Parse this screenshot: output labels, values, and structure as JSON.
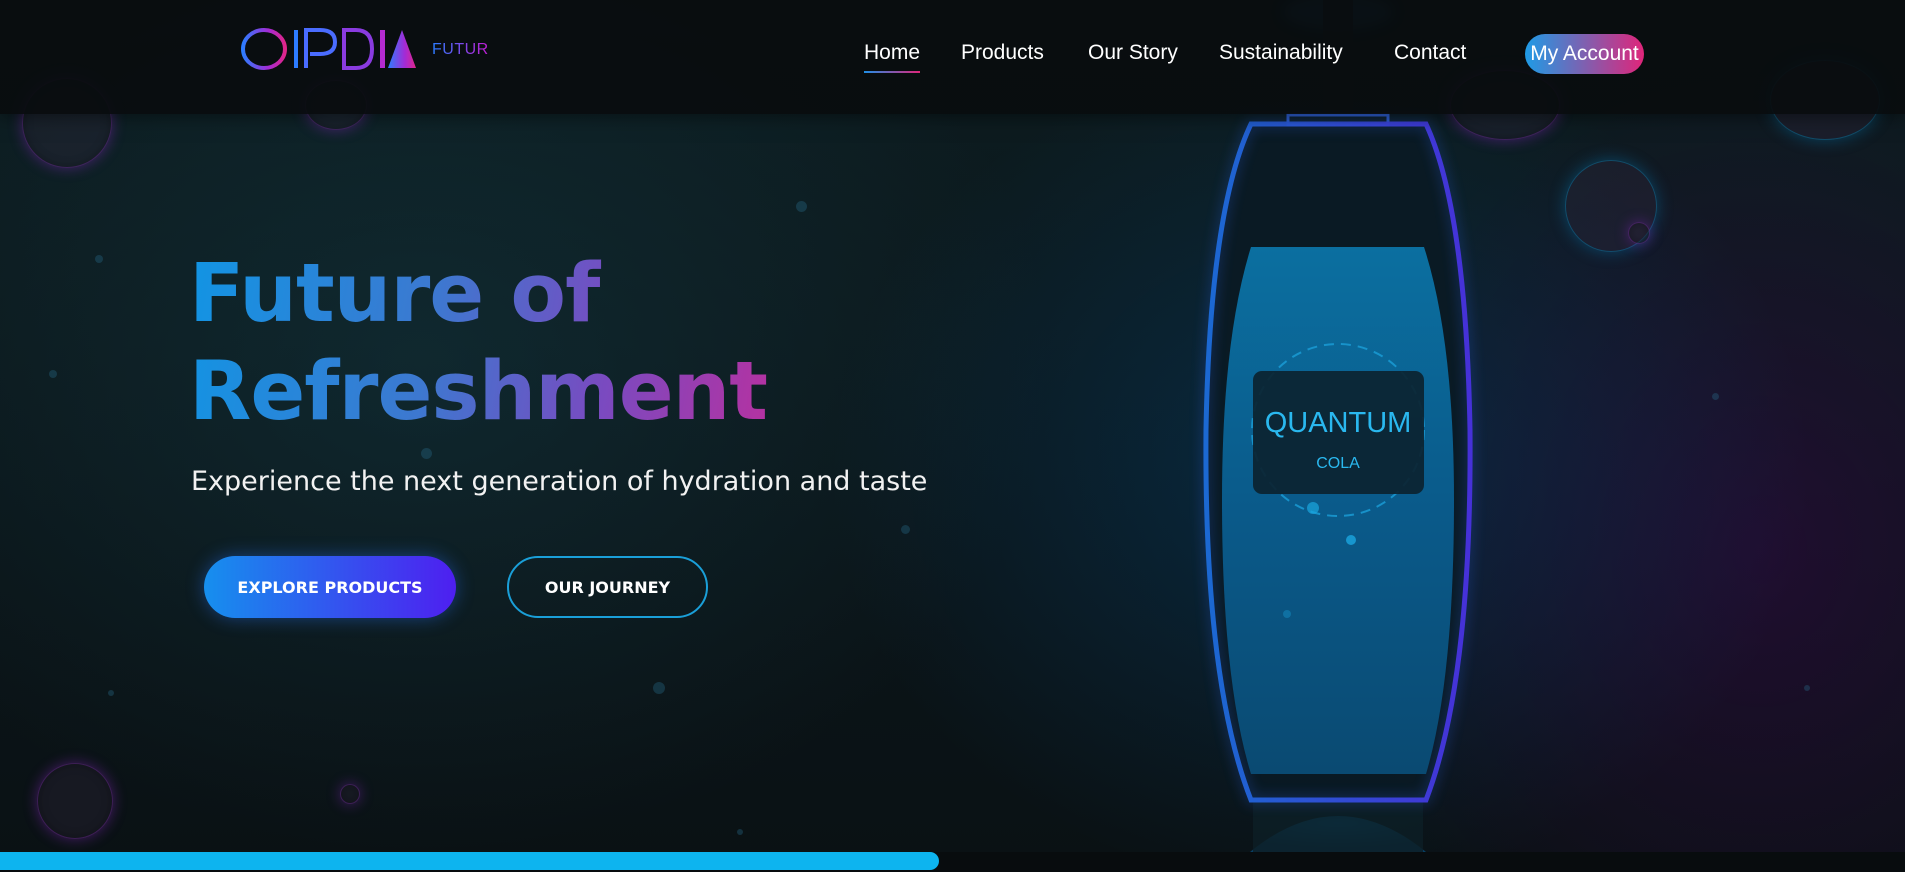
{
  "logo": {
    "mark": "OPDA",
    "suffix": "FUTUR"
  },
  "nav": {
    "items": [
      {
        "label": "Home",
        "active": true
      },
      {
        "label": "Products",
        "active": false
      },
      {
        "label": "Our Story",
        "active": false
      },
      {
        "label": "Sustainability",
        "active": false
      },
      {
        "label": "Contact",
        "active": false
      }
    ],
    "account_label": "My Account"
  },
  "hero": {
    "title_line1": "Future of",
    "title_line2": "Refreshment",
    "subtitle": "Experience the next generation of hydration and taste",
    "primary_cta": "EXPLORE PRODUCTS",
    "secondary_cta": "OUR JOURNEY"
  },
  "product": {
    "brand": "QUANTUM",
    "flavor": "COLA"
  },
  "scroll_progress": 0.493,
  "colors": {
    "accent_blue": "#0db4ef",
    "accent_pink": "#e0257a",
    "accent_purple": "#4e1ff0",
    "background": "#0a1316"
  },
  "icons": {
    "logo": "opda-neon-wordmark"
  }
}
